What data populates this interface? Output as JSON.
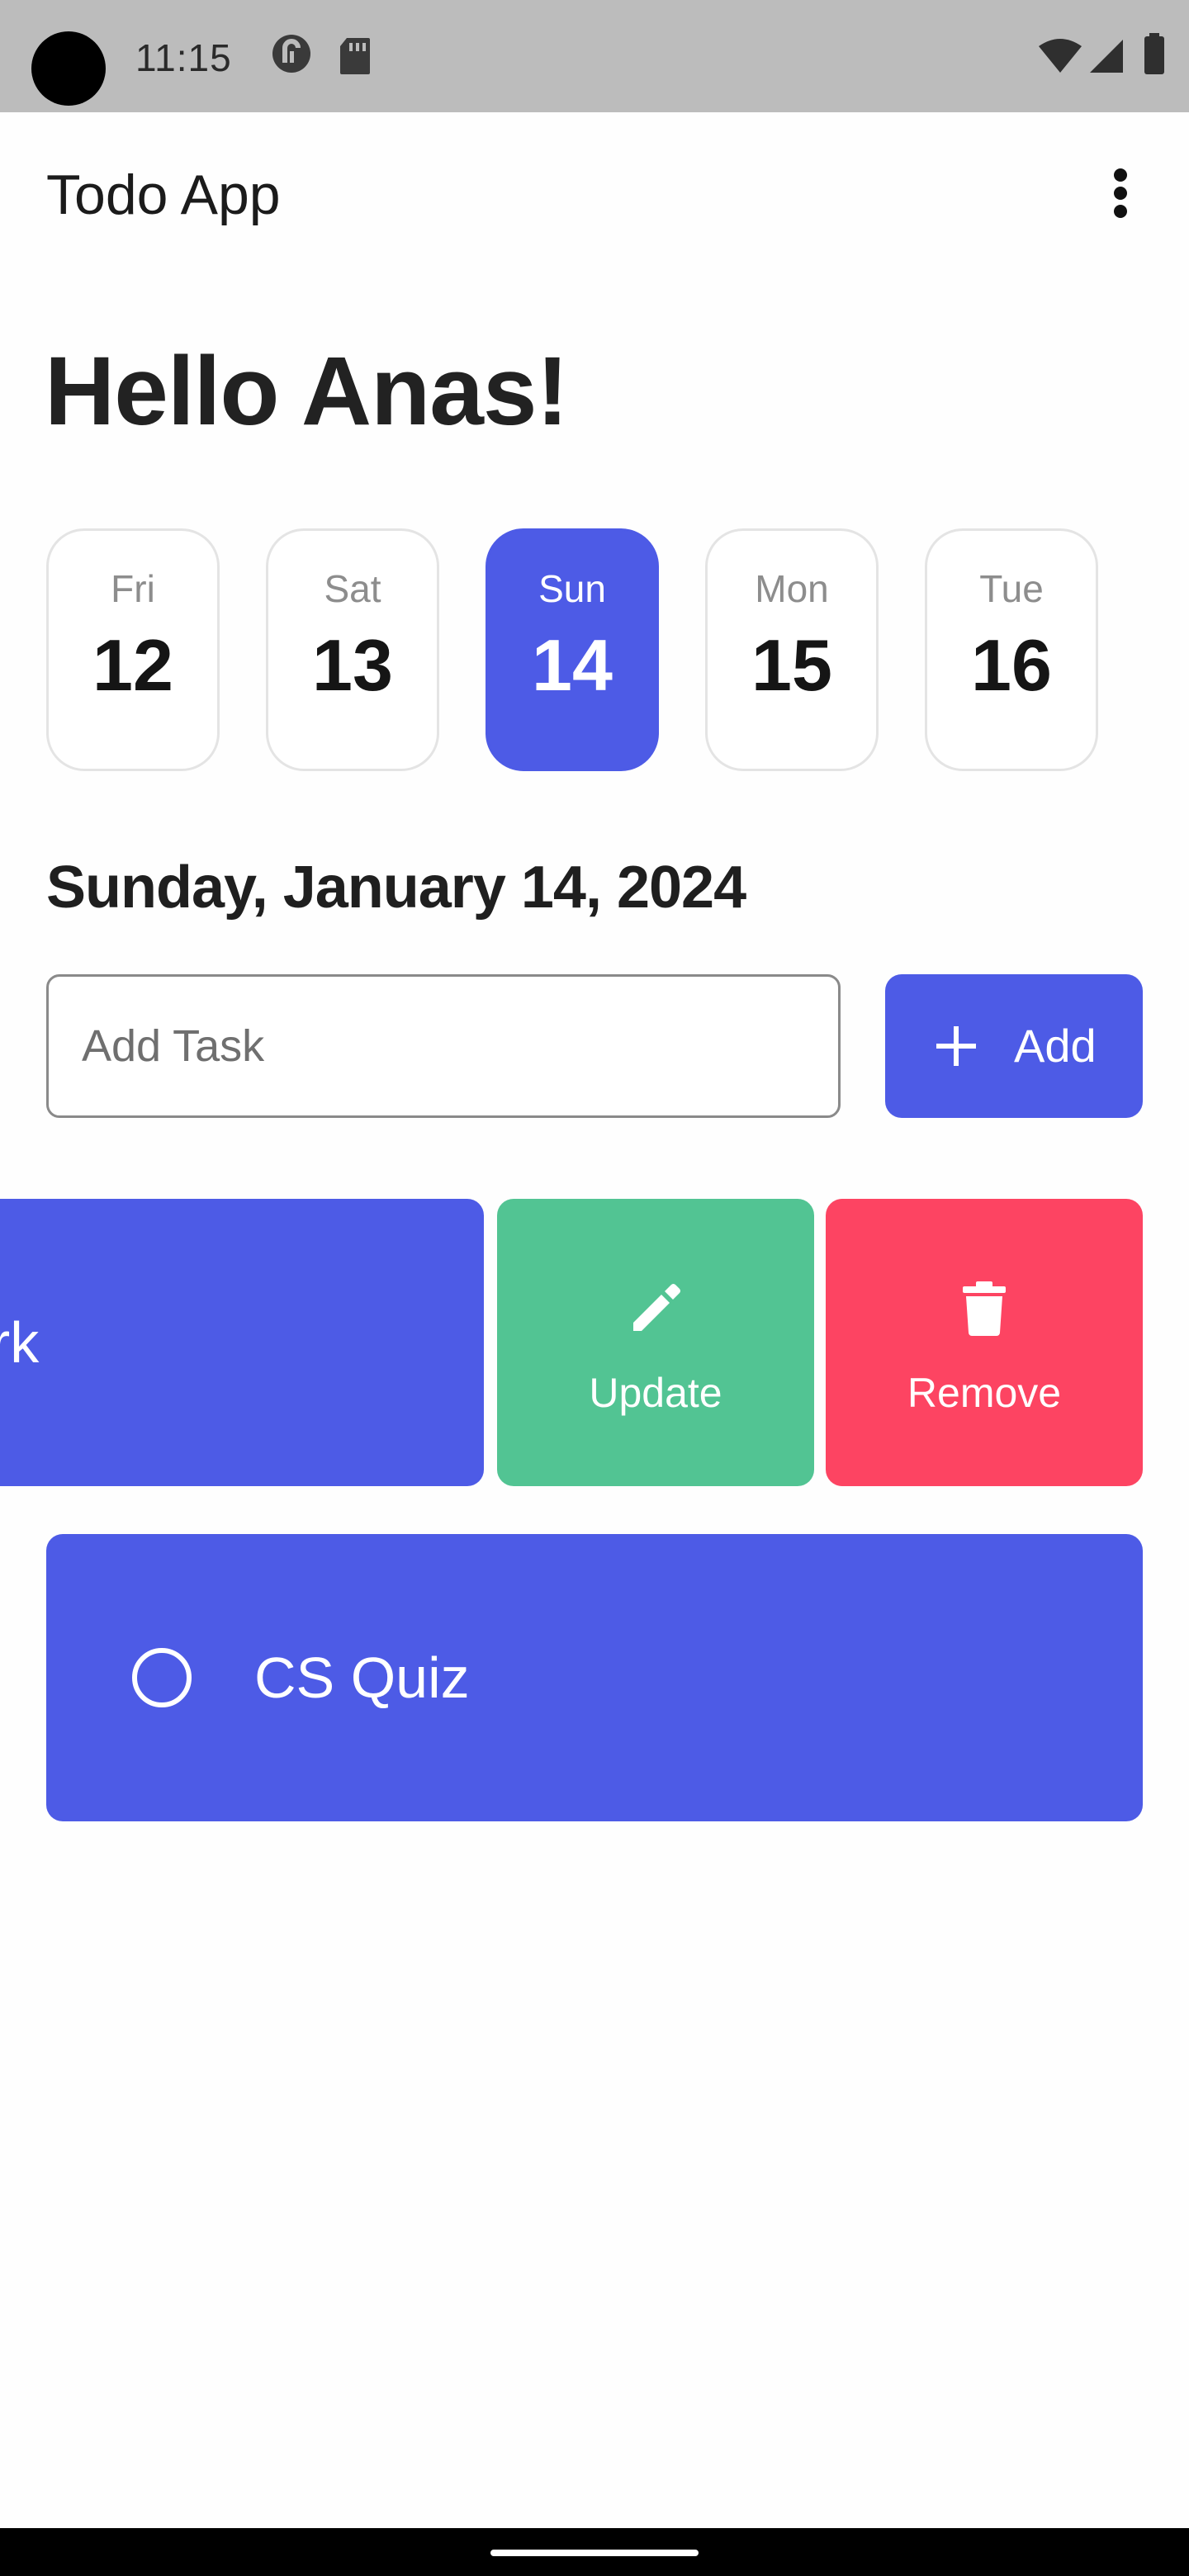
{
  "status_bar": {
    "time": "11:15",
    "left_icons": [
      "pocket-casts-icon",
      "sd-card-icon"
    ],
    "right_icons": [
      "wifi-icon",
      "signal-icon",
      "battery-icon"
    ]
  },
  "app_bar": {
    "title": "Todo App",
    "menu_icon": "more-vert-icon"
  },
  "greeting": "Hello Anas!",
  "days": [
    {
      "name": "Fri",
      "num": "12",
      "selected": false
    },
    {
      "name": "Sat",
      "num": "13",
      "selected": false
    },
    {
      "name": "Sun",
      "num": "14",
      "selected": true
    },
    {
      "name": "Mon",
      "num": "15",
      "selected": false
    },
    {
      "name": "Tue",
      "num": "16",
      "selected": false
    }
  ],
  "selected_date": "Sunday, January 14, 2024",
  "add_task": {
    "placeholder": "Add Task",
    "value": "",
    "button_label": "Add",
    "button_icon": "plus-icon"
  },
  "tasks": [
    {
      "title_visible": "ork",
      "swiped": true,
      "actions": [
        {
          "label": "Update",
          "icon": "pencil-icon",
          "color": "#52c493"
        },
        {
          "label": "Remove",
          "icon": "trash-icon",
          "color": "#fd4462"
        }
      ]
    },
    {
      "title": "CS Quiz",
      "completed": false,
      "check_icon": "circle-outline-icon"
    }
  ],
  "colors": {
    "accent": "#4d5be6",
    "update": "#52c493",
    "remove": "#fd4462",
    "status_bar": "#bcbcbc"
  }
}
